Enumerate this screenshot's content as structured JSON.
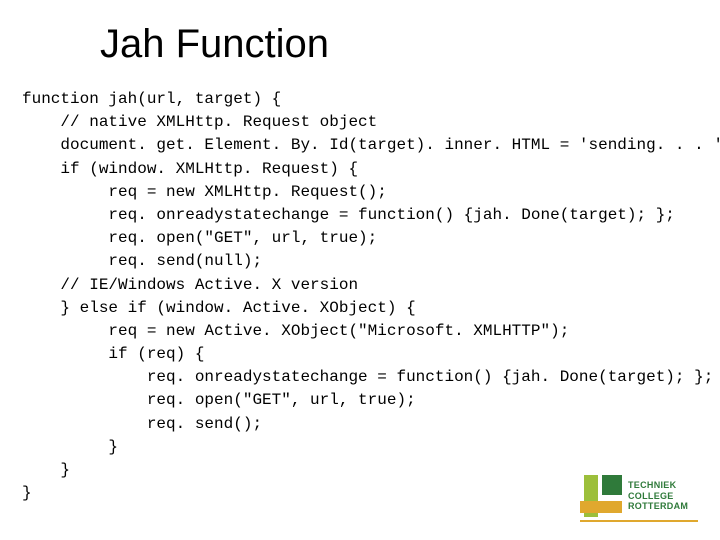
{
  "title": "Jah Function",
  "code": "function jah(url, target) {\n    // native XMLHttp. Request object\n    document. get. Element. By. Id(target). inner. HTML = 'sending. . . ';\n    if (window. XMLHttp. Request) {\n         req = new XMLHttp. Request();\n         req. onreadystatechange = function() {jah. Done(target); };\n         req. open(\"GET\", url, true);\n         req. send(null);\n    // IE/Windows Active. X version\n    } else if (window. Active. XObject) {\n         req = new Active. XObject(\"Microsoft. XMLHTTP\");\n         if (req) {\n             req. onreadystatechange = function() {jah. Done(target); };\n             req. open(\"GET\", url, true);\n             req. send();\n         }\n    }\n}",
  "logo": {
    "line1": "TECHNIEK",
    "line2": "COLLEGE",
    "line3": "ROTTERDAM"
  }
}
